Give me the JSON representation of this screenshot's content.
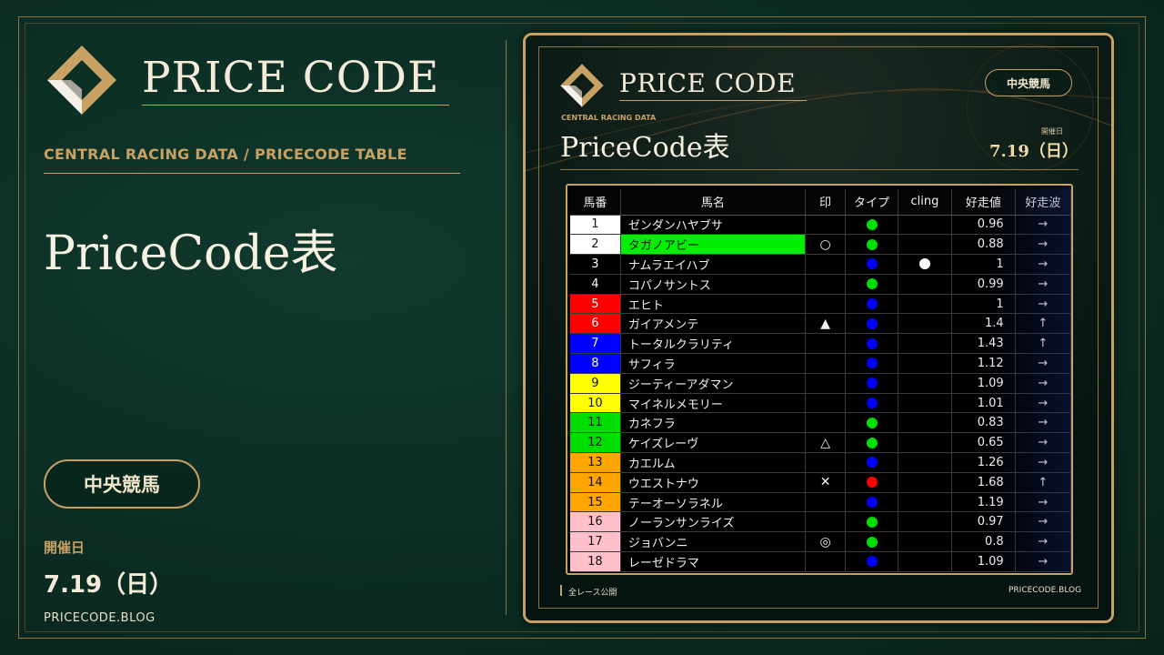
{
  "left": {
    "brand": "PRICE CODE",
    "subtitle": "CENTRAL RACING DATA / PRICECODE TABLE",
    "title": "PriceCode表",
    "pill": "中央競馬",
    "date_label": "開催日",
    "date": "7.19（日）",
    "blog": "PRICECODE.BLOG"
  },
  "card": {
    "brand": "PRICE CODE",
    "pill": "中央競馬",
    "subtitle": "CENTRAL RACING DATA",
    "title": "PriceCode表",
    "date_label": "開催日",
    "date": "7.19（日）",
    "footer_left": "全レース公開",
    "footer_right": "PRICECODE.BLOG"
  },
  "table": {
    "headers": [
      "馬番",
      "馬名",
      "印",
      "タイプ",
      "cling",
      "好走値",
      "好走波"
    ],
    "rows": [
      {
        "num": "1",
        "name": "ゼンダンハヤブサ",
        "mark": "",
        "type": "green",
        "cling": "",
        "val": "0.96",
        "wave": "→"
      },
      {
        "num": "2",
        "name": "タガノアビー",
        "mark": "○",
        "type": "green",
        "cling": "",
        "val": "0.88",
        "wave": "→",
        "highlight": "#00ee00"
      },
      {
        "num": "3",
        "name": "ナムラエイハブ",
        "mark": "",
        "type": "blue",
        "cling": "white",
        "val": "1",
        "wave": "→"
      },
      {
        "num": "4",
        "name": "コパノサントス",
        "mark": "",
        "type": "green",
        "cling": "",
        "val": "0.99",
        "wave": "→"
      },
      {
        "num": "5",
        "name": "エヒト",
        "mark": "",
        "type": "blue",
        "cling": "",
        "val": "1",
        "wave": "→"
      },
      {
        "num": "6",
        "name": "ガイアメンテ",
        "mark": "▲",
        "type": "blue",
        "cling": "",
        "val": "1.4",
        "wave": "↑"
      },
      {
        "num": "7",
        "name": "トータルクラリティ",
        "mark": "",
        "type": "blue",
        "cling": "",
        "val": "1.43",
        "wave": "↑"
      },
      {
        "num": "8",
        "name": "サフィラ",
        "mark": "",
        "type": "blue",
        "cling": "",
        "val": "1.12",
        "wave": "→"
      },
      {
        "num": "9",
        "name": "ジーティーアダマン",
        "mark": "",
        "type": "blue",
        "cling": "",
        "val": "1.09",
        "wave": "→"
      },
      {
        "num": "10",
        "name": "マイネルメモリー",
        "mark": "",
        "type": "blue",
        "cling": "",
        "val": "1.01",
        "wave": "→"
      },
      {
        "num": "11",
        "name": "カネフラ",
        "mark": "",
        "type": "green",
        "cling": "",
        "val": "0.83",
        "wave": "→"
      },
      {
        "num": "12",
        "name": "ケイズレーヴ",
        "mark": "△",
        "type": "green",
        "cling": "",
        "val": "0.65",
        "wave": "→"
      },
      {
        "num": "13",
        "name": "カエルム",
        "mark": "",
        "type": "blue",
        "cling": "",
        "val": "1.26",
        "wave": "→"
      },
      {
        "num": "14",
        "name": "ウエストナウ",
        "mark": "✕",
        "type": "red",
        "cling": "",
        "val": "1.68",
        "wave": "↑"
      },
      {
        "num": "15",
        "name": "テーオーソラネル",
        "mark": "",
        "type": "blue",
        "cling": "",
        "val": "1.19",
        "wave": "→"
      },
      {
        "num": "16",
        "name": "ノーランサンライズ",
        "mark": "",
        "type": "green",
        "cling": "",
        "val": "0.97",
        "wave": "→"
      },
      {
        "num": "17",
        "name": "ジョバンニ",
        "mark": "◎",
        "type": "green",
        "cling": "",
        "val": "0.8",
        "wave": "→"
      },
      {
        "num": "18",
        "name": "レーゼドラマ",
        "mark": "",
        "type": "blue",
        "cling": "",
        "val": "1.09",
        "wave": "→"
      }
    ],
    "gate_colors": {
      "1": "#ffffff",
      "2": "#ffffff",
      "3": "#000000",
      "4": "#000000",
      "5": "#ff0000",
      "6": "#ff0000",
      "7": "#0000ff",
      "8": "#0000ff",
      "9": "#ffff00",
      "10": "#ffff00",
      "11": "#00dd00",
      "12": "#00dd00",
      "13": "#ffa500",
      "14": "#ffa500",
      "15": "#ffa500",
      "16": "#ffc0cb",
      "17": "#ffc0cb",
      "18": "#ffc0cb"
    },
    "dot_colors": {
      "green": "#00dd00",
      "blue": "#0000ff",
      "red": "#ff0000",
      "white": "#ffffff"
    }
  },
  "colors": {
    "accent": "#c8a165",
    "background": "#0b2b22"
  }
}
